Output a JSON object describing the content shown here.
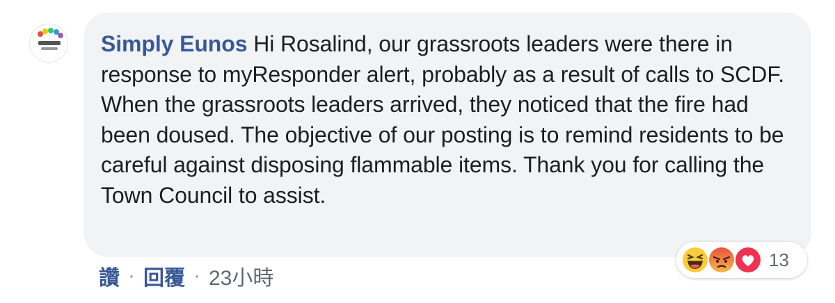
{
  "comment": {
    "author": "Simply Eunos",
    "text": "Hi Rosalind, our grassroots leaders were there in response to myResponder alert, probably as a result of calls to SCDF. When the grassroots leaders arrived, they noticed that the fire had been doused. The objective of our posting is to remind residents to be careful against disposing flammable items. Thank you for calling the Town Council to assist.",
    "avatar_icon": "simply-eunos-logo"
  },
  "reactions": {
    "icons": [
      "haha-icon",
      "angry-icon",
      "love-icon"
    ],
    "count": "13"
  },
  "actions": {
    "like_label": "讚",
    "reply_label": "回覆",
    "separator": "·",
    "time": "23小時"
  },
  "colors": {
    "author": "#385898",
    "bubble": "#f2f3f5",
    "text": "#1c1e21",
    "meta": "#606770"
  }
}
